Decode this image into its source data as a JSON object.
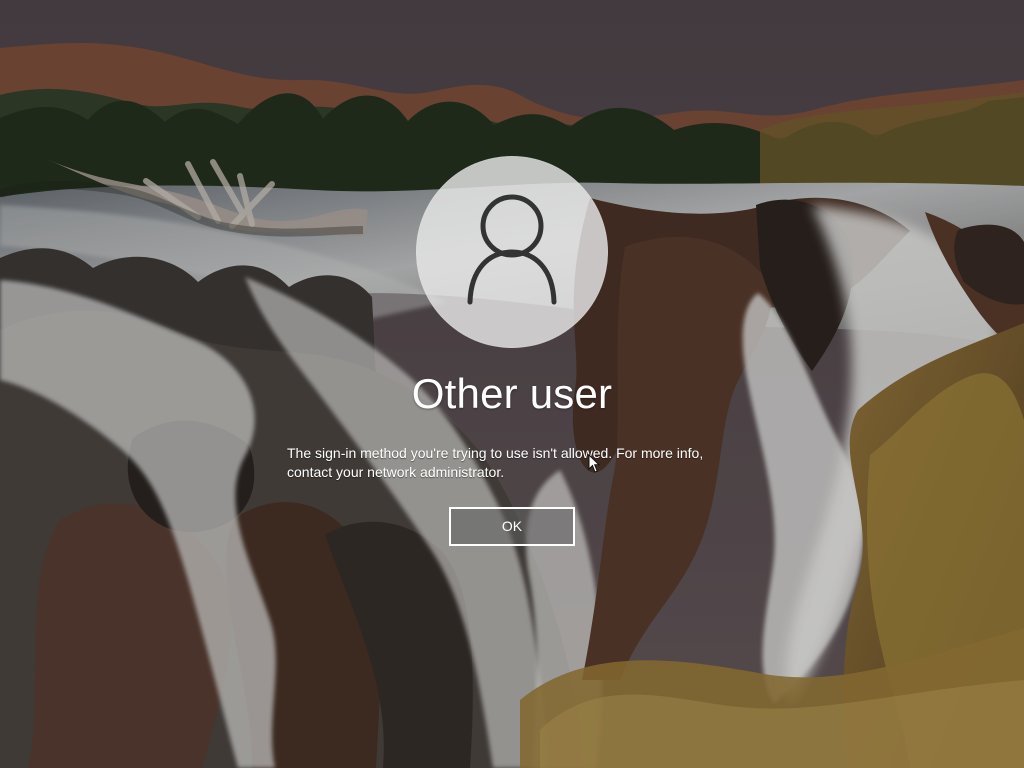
{
  "user": {
    "name": "Other user"
  },
  "message": {
    "text": "The sign-in method you're trying to use isn't allowed. For more info, contact your network administrator."
  },
  "actions": {
    "ok_label": "OK"
  },
  "icons": {
    "avatar": "user-silhouette-icon",
    "cursor": "mouse-pointer-icon"
  },
  "colors": {
    "text": "#ffffff",
    "button_border": "#ffffff",
    "avatar_background": "#e8e8e8",
    "avatar_icon": "#333333"
  }
}
